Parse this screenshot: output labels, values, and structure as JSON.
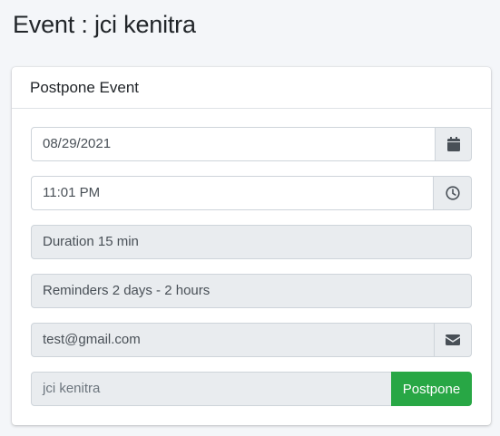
{
  "page": {
    "title": "Event : jci kenitra"
  },
  "card": {
    "header": "Postpone Event",
    "date_value": "08/29/2021",
    "date_icon": "calendar-icon",
    "time_value": "11:01 PM",
    "time_icon": "clock-icon",
    "duration_text": "Duration  15 min",
    "reminders_text": "Reminders 2 days - 2 hours",
    "email_value": "test@gmail.com",
    "email_icon": "envelope-icon",
    "event_name": "jci kenitra",
    "postpone_label": "Postpone"
  },
  "colors": {
    "accent_green": "#28a745",
    "readonly_bg": "#e9ecef",
    "page_bg": "#f4f6f9"
  }
}
